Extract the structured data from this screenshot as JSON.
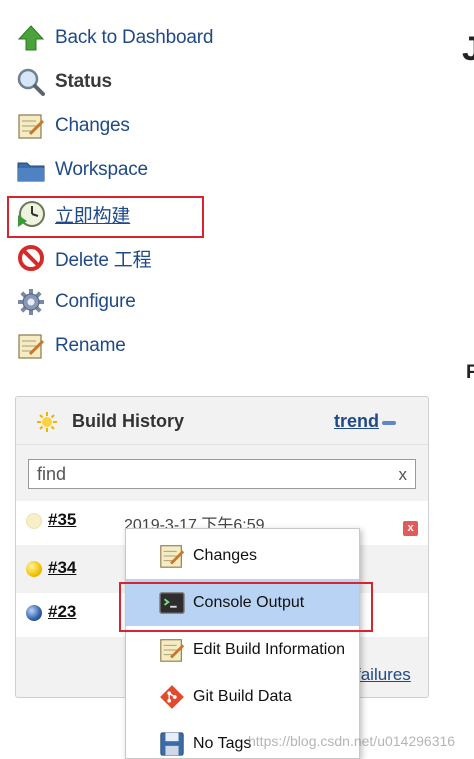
{
  "tasks": [
    {
      "label": "Back to Dashboard",
      "icon": "up-arrow-icon"
    },
    {
      "label": "Status",
      "icon": "magnifier-icon"
    },
    {
      "label": "Changes",
      "icon": "notepad-icon"
    },
    {
      "label": "Workspace",
      "icon": "folder-icon"
    },
    {
      "label": "立即构建",
      "icon": "build-clock-icon"
    },
    {
      "label": "Delete 工程",
      "icon": "no-entry-icon"
    },
    {
      "label": "Configure",
      "icon": "gear-icon"
    },
    {
      "label": "Rename",
      "icon": "notepad-icon"
    }
  ],
  "right_crop": {
    "top_glyph": "J",
    "mid_glyph": "F"
  },
  "build_history": {
    "title": "Build History",
    "trend_label": "trend",
    "search": {
      "value": "find",
      "clear": "x"
    },
    "builds": [
      {
        "number": "#35",
        "date": "2019-3-17 下午6:59",
        "status": "pending",
        "ball_color": "#f6efc8"
      },
      {
        "number": "#34",
        "date": "",
        "status": "unstable",
        "ball_color": "#f2c200"
      },
      {
        "number": "#23",
        "date": "",
        "status": "success",
        "ball_color": "#2f5fa8"
      }
    ],
    "delete_label": "x",
    "failures_link": "failures"
  },
  "context_menu": {
    "items": [
      {
        "label": "Changes",
        "icon": "notepad-icon",
        "selected": false
      },
      {
        "label": "Console Output",
        "icon": "terminal-icon",
        "selected": true
      },
      {
        "label": "Edit Build Information",
        "icon": "notepad-icon",
        "selected": false
      },
      {
        "label": "Git Build Data",
        "icon": "git-icon",
        "selected": false
      },
      {
        "label": "No Tags",
        "icon": "floppy-icon",
        "selected": false
      }
    ]
  },
  "watermark": "https://blog.csdn.net/u014296316",
  "colors": {
    "link": "#204a87",
    "highlight": "#d9232e",
    "menu_selected": "#b9d3f4"
  }
}
